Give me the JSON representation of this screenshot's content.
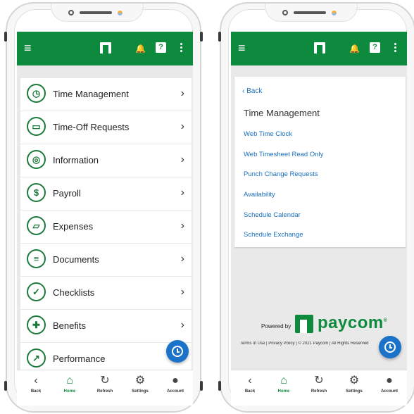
{
  "left_screen": {
    "menu_items": [
      {
        "label": "Time Management",
        "icon": "clock-icon",
        "glyph": "◷"
      },
      {
        "label": "Time-Off Requests",
        "icon": "travel-icon",
        "glyph": "▭"
      },
      {
        "label": "Information",
        "icon": "fingerprint-icon",
        "glyph": "◎"
      },
      {
        "label": "Payroll",
        "icon": "dollar-icon",
        "glyph": "$"
      },
      {
        "label": "Expenses",
        "icon": "card-icon",
        "glyph": "▱"
      },
      {
        "label": "Documents",
        "icon": "document-icon",
        "glyph": "≡"
      },
      {
        "label": "Checklists",
        "icon": "checklist-icon",
        "glyph": "✓"
      },
      {
        "label": "Benefits",
        "icon": "cross-icon",
        "glyph": "✚"
      },
      {
        "label": "Performance",
        "icon": "performance-icon",
        "glyph": "↗"
      }
    ],
    "chevron": "›"
  },
  "right_screen": {
    "back_label": "Back",
    "title": "Time Management",
    "links": [
      "Web Time Clock",
      "Web Timesheet Read Only",
      "Punch Change Requests",
      "Availability",
      "Schedule Calendar",
      "Schedule Exchange"
    ],
    "powered_by": "Powered by",
    "brand": "paycom",
    "brand_mark": "®",
    "footer": "Terms of Use | Privacy Policy | © 2021 Paycom | All Rights Reserved"
  },
  "header": {
    "menu_glyph": "≡",
    "bell_glyph": "🔔",
    "help_glyph": "?"
  },
  "tabbar": [
    {
      "label": "Back",
      "glyph": "‹",
      "icon": "back-icon"
    },
    {
      "label": "Home",
      "glyph": "⌂",
      "icon": "home-icon"
    },
    {
      "label": "Refresh",
      "glyph": "↻",
      "icon": "refresh-icon"
    },
    {
      "label": "Settings",
      "glyph": "⚙",
      "icon": "gear-icon"
    },
    {
      "label": "Account",
      "glyph": "●",
      "icon": "account-icon"
    }
  ],
  "colors": {
    "brand_green": "#0d8a3d",
    "link_blue": "#1a6fbf",
    "fab_blue": "#1a73c9"
  }
}
